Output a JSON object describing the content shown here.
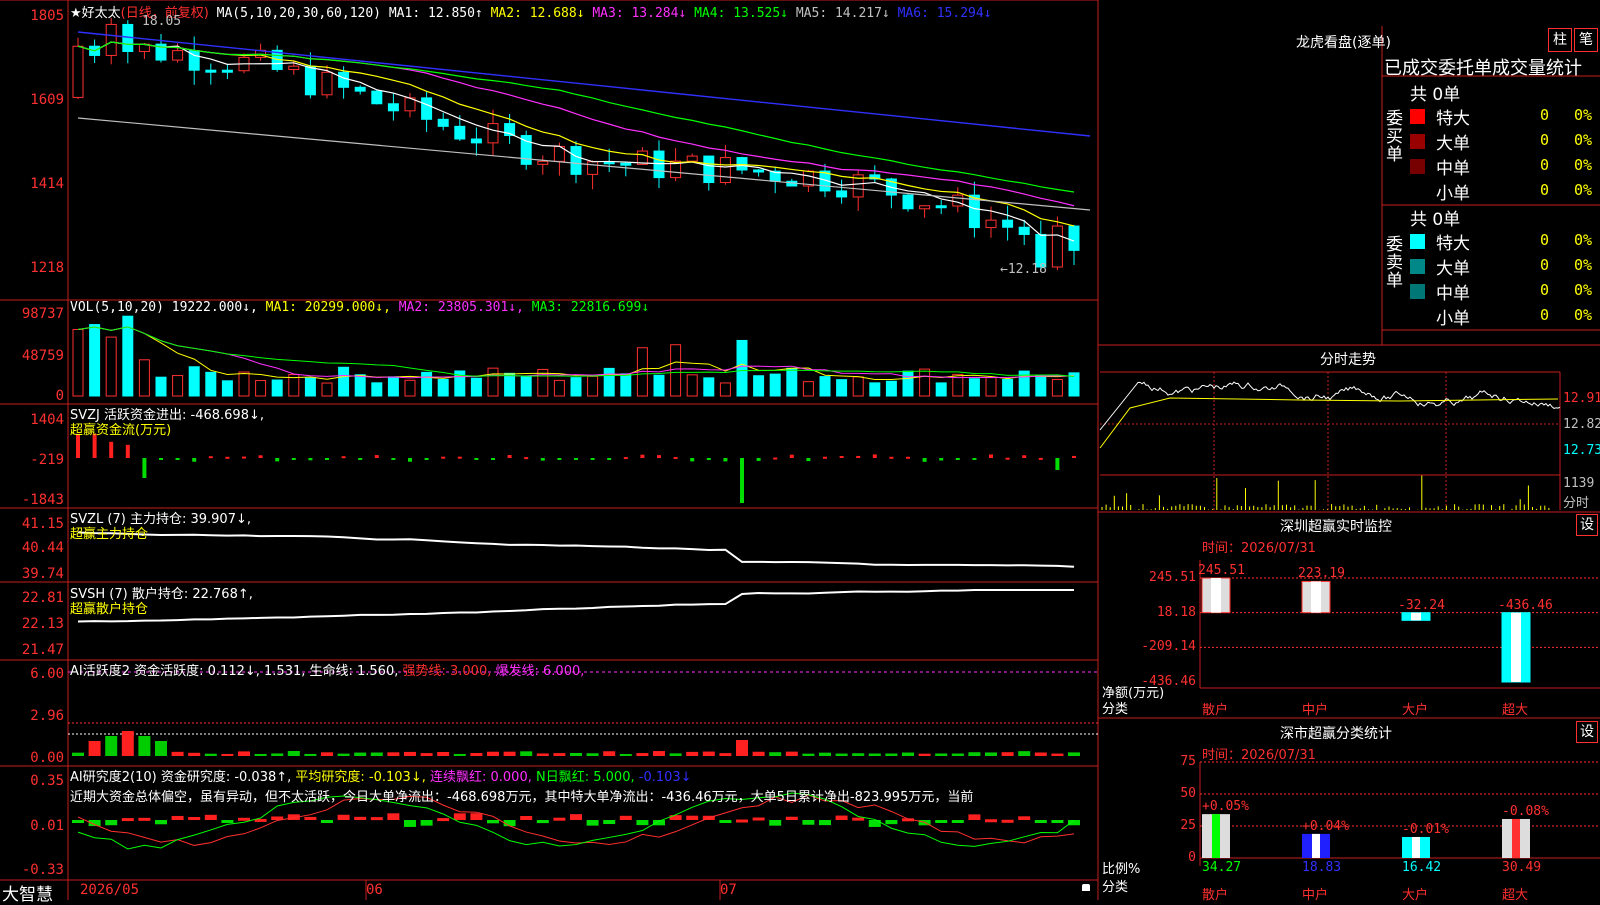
{
  "main": {
    "title_prefix": "★好太太",
    "title_mode": "(日线，前复权)",
    "ma_label": "MA(5,10,20,30,60,120)",
    "ma": [
      {
        "label": "MA1: 12.850↑",
        "color": "#ffffff"
      },
      {
        "label": "MA2: 12.688↓",
        "color": "#ffff00"
      },
      {
        "label": "MA3: 13.284↓",
        "color": "#ff30ff"
      },
      {
        "label": "MA4: 13.525↓",
        "color": "#00ff00"
      },
      {
        "label": "MA5: 14.217↓",
        "color": "#c0c0c0"
      },
      {
        "label": "MA6: 15.294↓",
        "color": "#3030ff"
      }
    ],
    "high_label": "18.05",
    "low_label": "←12.18",
    "y_ticks": [
      "1805",
      "1609",
      "1414",
      "1218"
    ]
  },
  "vol": {
    "label": "VOL(5,10,20)",
    "value": "19222.000↓,",
    "ma1": "MA1: 20299.000↓,",
    "ma2": "MA2: 23805.301↓,",
    "ma3": "MA3: 22816.699↓",
    "y_ticks": [
      "98737",
      "48759",
      "0"
    ]
  },
  "svzj": {
    "label": "SVZJ  活跃资金进出: -468.698↓,",
    "sub": "超赢资金流(万元)",
    "y_ticks": [
      "1404",
      "-219",
      "-1843"
    ]
  },
  "svzl": {
    "label": "SVZL (7) 主力持仓: 39.907↓,",
    "sub": "超赢主力持仓",
    "y_ticks": [
      "41.15",
      "40.44",
      "39.74"
    ]
  },
  "svsh": {
    "label": "SVSH (7) 散户持仓: 22.768↑,",
    "sub": "超赢散户持仓",
    "y_ticks": [
      "22.81",
      "22.13",
      "21.47"
    ]
  },
  "ai_active": {
    "label": "AI活跃度2 资金活跃度: 0.112↓, 1.531, 生命线: 1.560,",
    "strong": "强势线: 3.000,",
    "burst": "爆发线: 6.000,",
    "y_ticks": [
      "6.00",
      "2.96",
      "0.00"
    ]
  },
  "ai_research": {
    "label": "AI研究度2(10) 资金研究度: -0.038↑,",
    "avg": "平均研究度: -0.103↓,",
    "streak": "连续飘红: 0.000,",
    "nday": "N日飘红: 5.000,",
    "last": "-0.103↓",
    "summary": "近期大资金总体偏空，虽有异动，但不太活跃，今日大单净流出：-468.698万元，其中特大单净流出：-436.46万元，大单5日累计净出-823.995万元，当前",
    "y_ticks": [
      "0.35",
      "0.01",
      "-0.33"
    ]
  },
  "bottom": {
    "brand": "大智慧",
    "dates": [
      "2026/05",
      "06",
      "07"
    ]
  },
  "lhb": {
    "title": "龙虎看盘(逐单)",
    "btn_column": "柱",
    "btn_pen": "笔",
    "tab_header": "已成交委托单成交量统计",
    "buy_side": "委买单",
    "sell_side": "委卖单",
    "buy_total": "共 0单",
    "sell_total": "共 0单",
    "buy_rows": [
      {
        "name": "特大",
        "count": "0",
        "pct": "0%",
        "color": "#ff0000"
      },
      {
        "name": "大单",
        "count": "0",
        "pct": "0%",
        "color": "#990000"
      },
      {
        "name": "中单",
        "count": "0",
        "pct": "0%",
        "color": "#770000"
      },
      {
        "name": "小单",
        "count": "0",
        "pct": "0%",
        "color": "#000000"
      }
    ],
    "sell_rows": [
      {
        "name": "特大",
        "count": "0",
        "pct": "0%",
        "color": "#00ffff"
      },
      {
        "name": "大单",
        "count": "0",
        "pct": "0%",
        "color": "#008888"
      },
      {
        "name": "中单",
        "count": "0",
        "pct": "0%",
        "color": "#007777"
      },
      {
        "name": "小单",
        "count": "0",
        "pct": "0%",
        "color": "#000000"
      }
    ]
  },
  "intraday": {
    "title": "分时走势",
    "right_ticks": [
      "12.91",
      "12.82",
      "12.73"
    ],
    "vol_tick": "1139",
    "vol_unit": "分时"
  },
  "sz_monitor": {
    "title": "深圳超赢实时监控",
    "settings": "设",
    "time": "时间：2026/07/31",
    "y_ticks": [
      "245.51",
      "18.18",
      "-209.14",
      "-436.46"
    ],
    "y_caption": "净额(万元)",
    "x_caption": "分类",
    "bars": [
      {
        "cat": "散户",
        "value": 245.51,
        "label": "245.51"
      },
      {
        "cat": "中户",
        "value": 223.19,
        "label": "223.19"
      },
      {
        "cat": "大户",
        "value": -32.24,
        "label": "-32.24"
      },
      {
        "cat": "超大",
        "value": -436.46,
        "label": "-436.46"
      }
    ]
  },
  "sz_stats": {
    "title": "深市超赢分类统计",
    "settings": "设",
    "time": "时间：2026/07/31",
    "y_ticks": [
      "75",
      "50",
      "25",
      "0"
    ],
    "y_caption": "比例%",
    "x_caption": "分类",
    "bars": [
      {
        "cat": "散户",
        "value": 34.27,
        "change": "+0.05%",
        "pct": "34.27"
      },
      {
        "cat": "中户",
        "value": 18.83,
        "change": "+0.04%",
        "pct": "18.83"
      },
      {
        "cat": "大户",
        "value": 16.42,
        "change": "-0.01%",
        "pct": "16.42"
      },
      {
        "cat": "超大",
        "value": 30.49,
        "change": "-0.08%",
        "pct": "30.49"
      }
    ]
  }
}
